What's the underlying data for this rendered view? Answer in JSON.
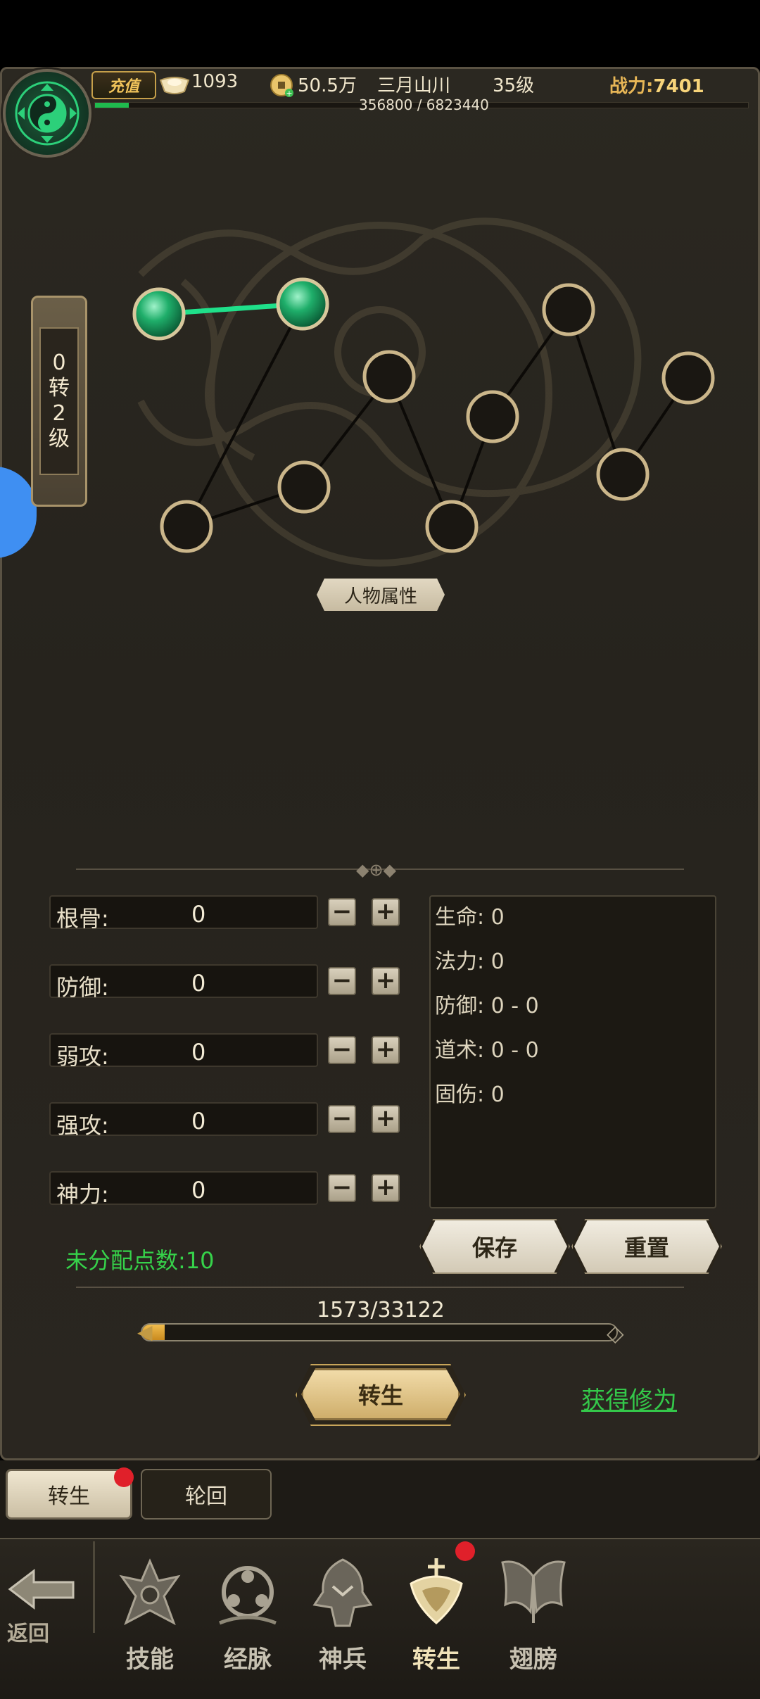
{
  "header": {
    "recharge_label": "充值",
    "ingot_count": "1093",
    "coin_amount": "50.5万",
    "player_name": "三月山川",
    "player_level": "35级",
    "exp_text": "356800 / 6823440",
    "exp_progress": 0.052,
    "power_label": "战力:",
    "power_value": "7401",
    "avatar_icon": "yin-yang-icon"
  },
  "reincarnation": {
    "level_chars": [
      "0",
      "转",
      "2",
      "级"
    ],
    "nodes_total": 11,
    "nodes_activated": 2,
    "attribute_tag": "人物属性"
  },
  "stats": {
    "rows": [
      {
        "name": "根骨:",
        "value": "0"
      },
      {
        "name": "防御:",
        "value": "0"
      },
      {
        "name": "弱攻:",
        "value": "0"
      },
      {
        "name": "强攻:",
        "value": "0"
      },
      {
        "name": "神力:",
        "value": "0"
      }
    ],
    "minus_label": "−",
    "plus_label": "+",
    "results": [
      "生命: 0",
      "法力: 0",
      "防御: 0 - 0",
      "道术: 0 - 0",
      "固伤: 0"
    ],
    "unassigned": "未分配点数:10",
    "save_label": "保存",
    "reset_label": "重置"
  },
  "progress": {
    "text": "1573/33122",
    "fraction": 0.0475
  },
  "actions": {
    "reincarnate_label": "转生",
    "gain_label": "获得修为"
  },
  "sub_tabs": [
    "转生",
    "轮回"
  ],
  "bottom_nav": {
    "back_label": "返回",
    "items": [
      {
        "label": "技能",
        "icon": "skill-icon"
      },
      {
        "label": "经脉",
        "icon": "meridian-icon"
      },
      {
        "label": "神兵",
        "icon": "weapon-icon"
      },
      {
        "label": "转生",
        "icon": "reincarnation-icon"
      },
      {
        "label": "翅膀",
        "icon": "wings-icon"
      }
    ]
  },
  "colors": {
    "active_node": "#1fae6a",
    "gold": "#e7b656",
    "green_text": "#36d24a",
    "badge_red": "#e0202a"
  }
}
